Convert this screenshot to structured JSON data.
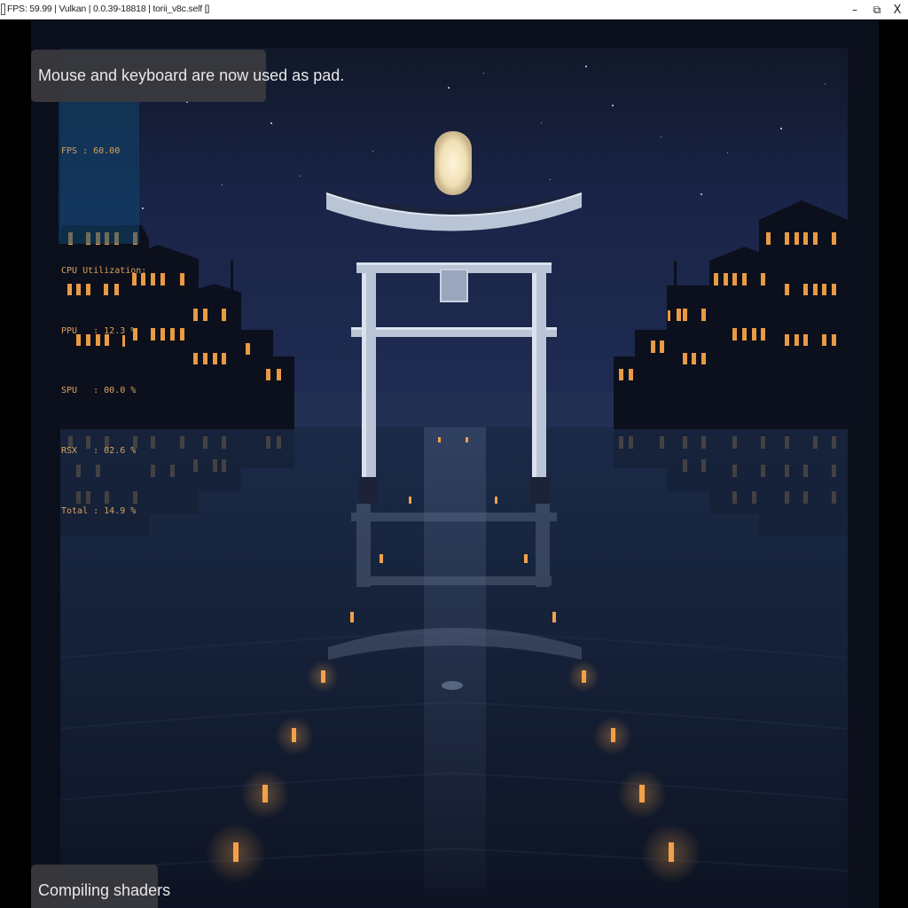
{
  "window": {
    "title": "FPS: 59.99 | Vulkan | 0.0.39-18818 | torii_v8c.self []",
    "minimize_icon": "minimize-icon",
    "maximize_icon": "restore-icon",
    "close_icon": "close-icon",
    "minimize_glyph": "–",
    "maximize_glyph": "⧉",
    "close_glyph": "X"
  },
  "notification": {
    "text": "Mouse and keyboard are now used as pad."
  },
  "perf_overlay": {
    "fps_line": "FPS : 60.00",
    "cpu_header": "CPU Utilization:",
    "ppu_line": "PPU   : 12.3 %",
    "spu_line": "SPU   : 00.0 %",
    "rsx_line": "RSX   : 02.6 %",
    "total_line": "Total : 14.9 %",
    "text_color": "#d8a25c"
  },
  "status": {
    "compiling_text": "Compiling shaders",
    "spinner_icon": "loading-spinner-icon"
  },
  "scene": {
    "description_icon": "torii-gate-night-scene",
    "sky_color": "#17203f",
    "water_color": "#152036",
    "moon_color": "#f4e6c4",
    "lantern_color": "#f2a04a",
    "window_light_color": "#e89a44"
  }
}
